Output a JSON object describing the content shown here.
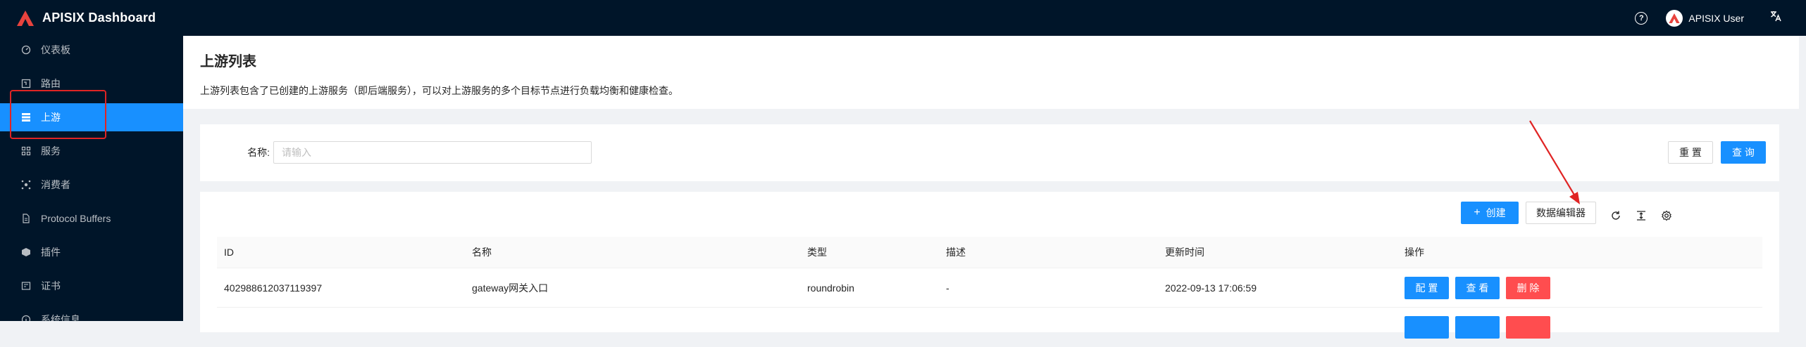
{
  "app": {
    "title": "APISIX Dashboard"
  },
  "header": {
    "user_name": "APISIX User",
    "help_icon": "help-icon",
    "lang_icon": "translate-icon"
  },
  "sidebar": {
    "items": [
      {
        "label": "仪表板",
        "icon": "dashboard-icon",
        "active": false
      },
      {
        "label": "路由",
        "icon": "route-icon",
        "active": false
      },
      {
        "label": "上游",
        "icon": "upstream-icon",
        "active": true
      },
      {
        "label": "服务",
        "icon": "service-icon",
        "active": false
      },
      {
        "label": "消费者",
        "icon": "consumer-icon",
        "active": false
      },
      {
        "label": "Protocol Buffers",
        "icon": "file-icon",
        "active": false
      },
      {
        "label": "插件",
        "icon": "plugin-icon",
        "active": false
      },
      {
        "label": "证书",
        "icon": "certificate-icon",
        "active": false
      },
      {
        "label": "系统信息",
        "icon": "info-icon",
        "active": false
      }
    ]
  },
  "page": {
    "title": "上游列表",
    "description": "上游列表包含了已创建的上游服务（即后端服务），可以对上游服务的多个目标节点进行负载均衡和健康检查。"
  },
  "search": {
    "name_label": "名称:",
    "name_placeholder": "请输入",
    "reset_label": "重 置",
    "query_label": "查 询"
  },
  "toolbar": {
    "create_label": "创建",
    "data_editor_label": "数据编辑器"
  },
  "table": {
    "columns": [
      "ID",
      "名称",
      "类型",
      "描述",
      "更新时间",
      "操作"
    ],
    "rows": [
      {
        "id": "402988612037119397",
        "name": "gateway网关入口",
        "type": "roundrobin",
        "desc": "-",
        "updated": "2022-09-13 17:06:59",
        "actions": [
          "配 置",
          "查 看",
          "删 除"
        ]
      }
    ]
  },
  "colors": {
    "primary": "#1890ff",
    "danger": "#ff4d4f",
    "sider": "#001529",
    "annotation": "#e02424"
  }
}
